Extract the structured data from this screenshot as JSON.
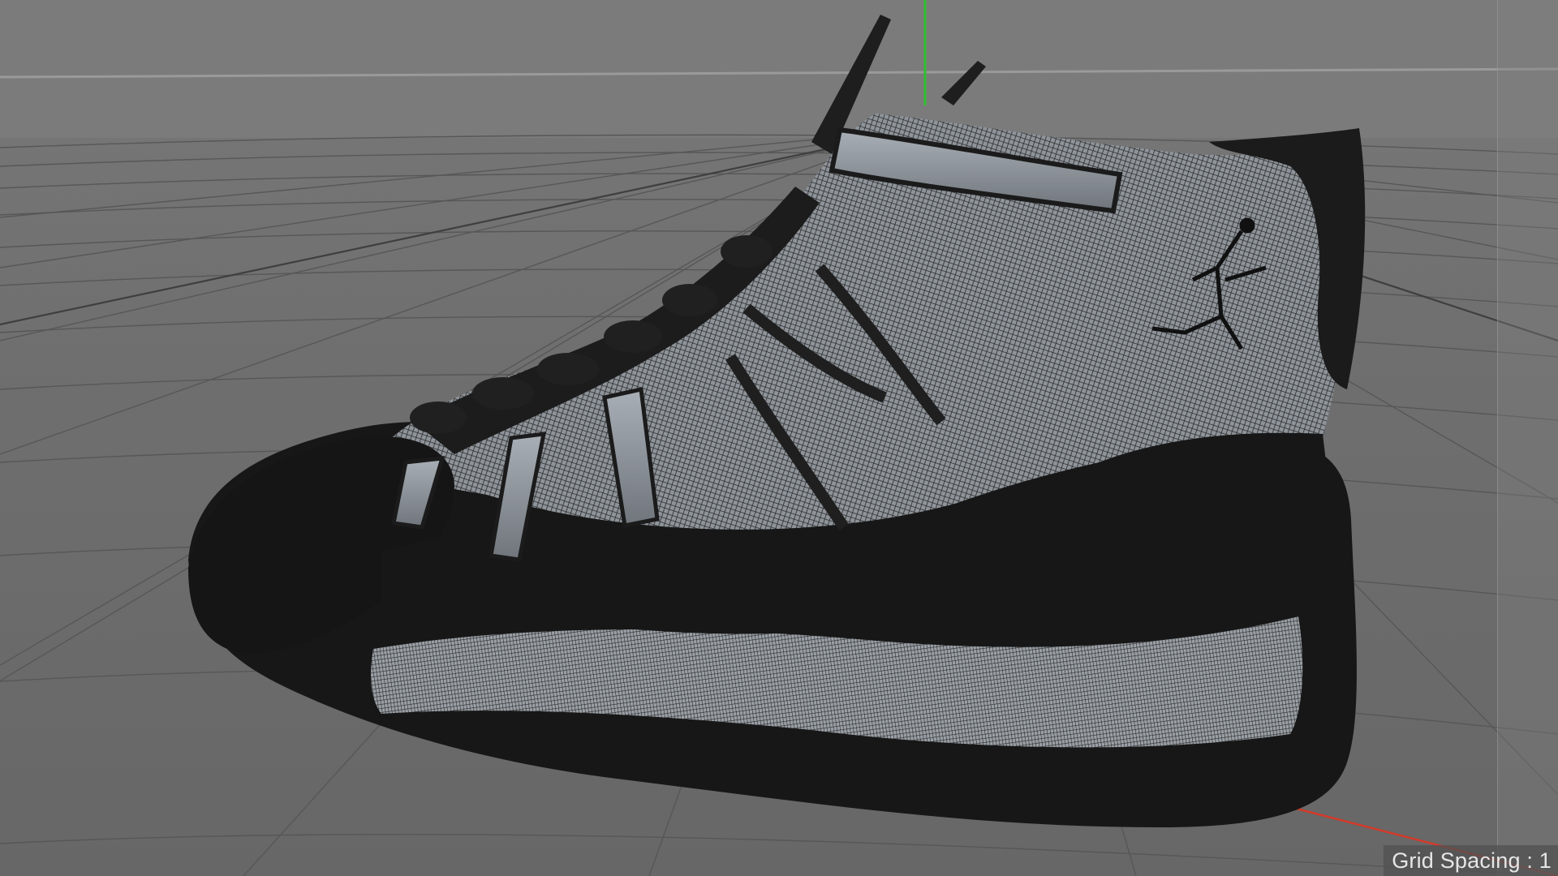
{
  "viewport": {
    "background_color": "#6f6f6f",
    "grid_color": "#5a5a5a",
    "y_axis_color": "#2fbf2f",
    "x_axis_color": "#d23a2a",
    "grid_spacing_label": "Grid Spacing : 1",
    "object_icon": "sneaker-wireframe-model"
  }
}
